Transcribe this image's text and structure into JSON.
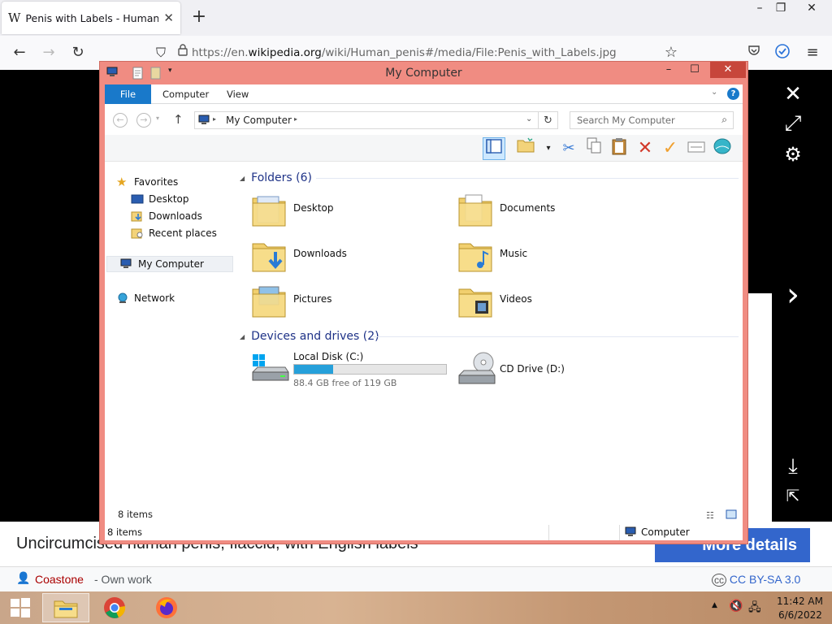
{
  "browser": {
    "tab_title": "Penis with Labels - Human peni",
    "favicon": "W",
    "url_prefix": "https://en.",
    "url_domain": "wikipedia.org",
    "url_path": "/wiki/Human_penis#/media/File:Penis_with_Labels.jpg"
  },
  "media_viewer": {
    "caption": "Uncircumcised human penis, flaccid, with English labels",
    "more_details": "More details",
    "author": "Coastone",
    "author_suffix": "- Own work",
    "license": "CC BY-SA 3.0"
  },
  "explorer": {
    "title": "My Computer",
    "ribbon_tabs": [
      "File",
      "Computer",
      "View"
    ],
    "breadcrumb": "My Computer",
    "search_placeholder": "Search My Computer",
    "nav": {
      "favorites": "Favorites",
      "desktop": "Desktop",
      "downloads": "Downloads",
      "recent": "Recent places",
      "my_computer": "My Computer",
      "network": "Network"
    },
    "folders_header": "Folders (6)",
    "folders": [
      "Desktop",
      "Documents",
      "Downloads",
      "Music",
      "Pictures",
      "Videos"
    ],
    "devices_header": "Devices and drives (2)",
    "drive_c": {
      "label": "Local Disk (C:)",
      "free_text": "88.4 GB free of 119 GB",
      "used_fraction": 0.257
    },
    "drive_d": {
      "label": "CD Drive (D:)"
    },
    "status_inner": "8 items",
    "status_outer": "8 items",
    "status_location": "Computer"
  },
  "taskbar": {
    "time": "11:42 AM",
    "date": "6/6/2022"
  },
  "colors": {
    "window_frame": "#f08c82",
    "accent": "#1979ca",
    "drive_fill": "#26a0da",
    "wiki_blue": "#3366cc",
    "author_red": "#aa0000"
  }
}
